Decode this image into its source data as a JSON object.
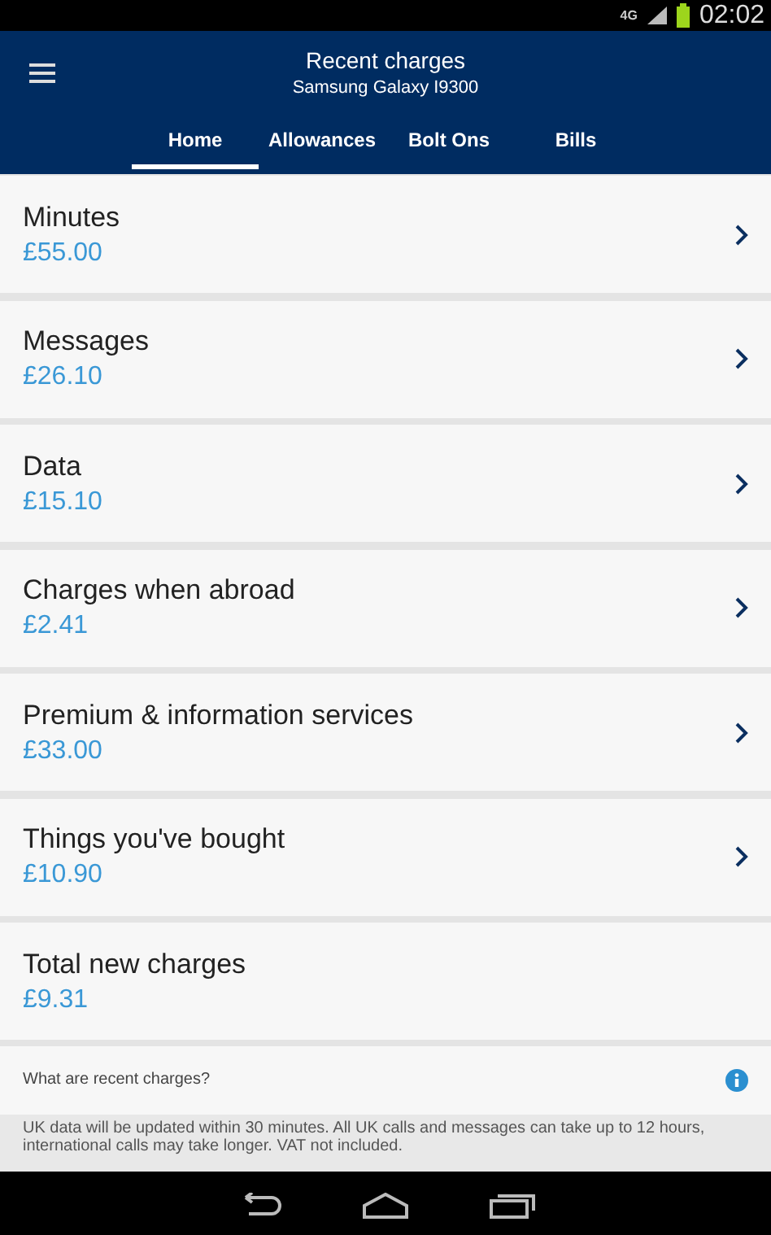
{
  "status_bar": {
    "network": "4G",
    "time": "02:02"
  },
  "header": {
    "title": "Recent charges",
    "subtitle": "Samsung Galaxy I9300"
  },
  "tabs": [
    {
      "label": "Home",
      "selected": true
    },
    {
      "label": "Allowances",
      "selected": false
    },
    {
      "label": "Bolt Ons",
      "selected": false
    },
    {
      "label": "Bills",
      "selected": false
    }
  ],
  "charges": [
    {
      "name": "Minutes",
      "amount": "£55.00",
      "has_chevron": true
    },
    {
      "name": "Messages",
      "amount": "£26.10",
      "has_chevron": true
    },
    {
      "name": "Data",
      "amount": "£15.10",
      "has_chevron": true
    },
    {
      "name": "Charges when abroad",
      "amount": "£2.41",
      "has_chevron": true
    },
    {
      "name": "Premium & information services",
      "amount": "£33.00",
      "has_chevron": true
    },
    {
      "name": "Things you've bought",
      "amount": "£10.90",
      "has_chevron": true
    },
    {
      "name": "Total new charges",
      "amount": "£9.31",
      "has_chevron": false
    }
  ],
  "info_link": "What are recent charges?",
  "footnote": "UK data will be updated within 30 minutes. All UK calls and messages can take up to 12 hours, international calls may take longer. VAT not included."
}
